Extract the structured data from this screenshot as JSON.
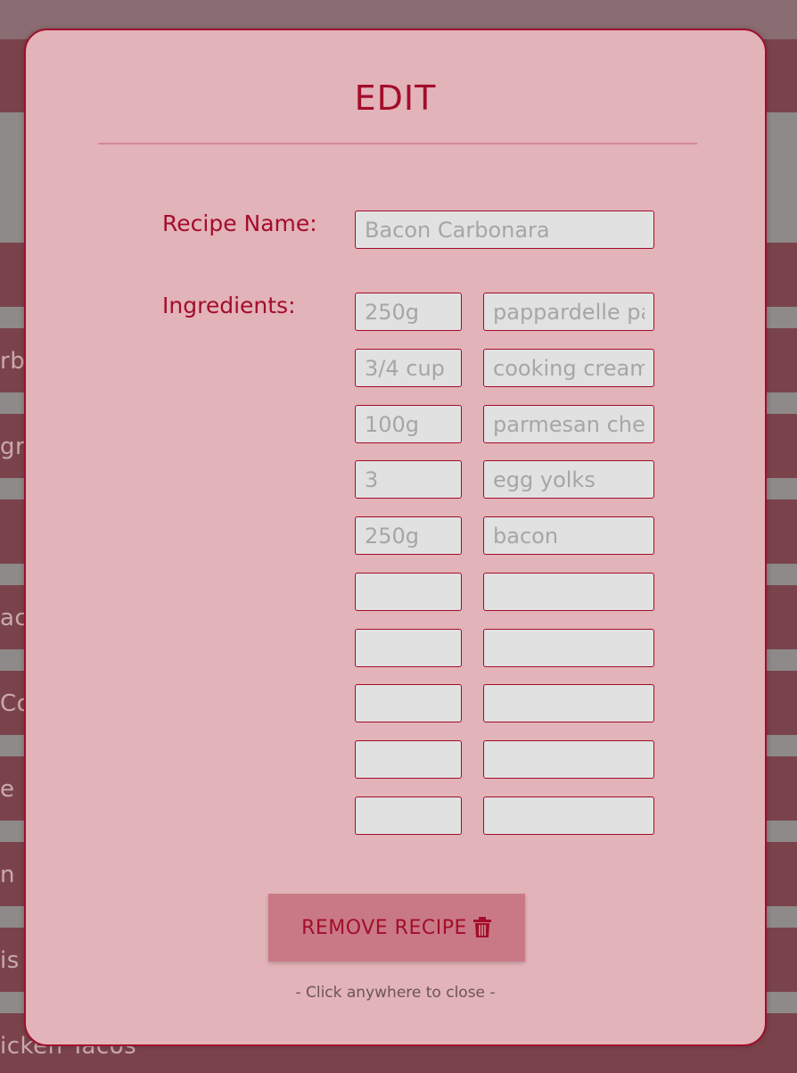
{
  "background": {
    "row_fragments": [
      "rb",
      "gr",
      "ac",
      "Co",
      "e S",
      "n R",
      "is",
      "icken Tacos"
    ]
  },
  "modal": {
    "title": "EDIT",
    "recipe_name_label": "Recipe Name:",
    "recipe_name_placeholder": "Bacon Carbonara",
    "ingredients_label": "Ingredients:",
    "ingredients": [
      {
        "qty": "250g",
        "item": "pappardelle pasta"
      },
      {
        "qty": "3/4 cup",
        "item": "cooking cream"
      },
      {
        "qty": "100g",
        "item": "parmesan cheese"
      },
      {
        "qty": "3",
        "item": "egg yolks"
      },
      {
        "qty": "250g",
        "item": "bacon"
      },
      {
        "qty": "",
        "item": ""
      },
      {
        "qty": "",
        "item": ""
      },
      {
        "qty": "",
        "item": ""
      },
      {
        "qty": "",
        "item": ""
      },
      {
        "qty": "",
        "item": ""
      }
    ],
    "remove_button_label": "REMOVE RECIPE",
    "close_hint": "- Click anywhere to close -"
  },
  "colors": {
    "accent": "#a30d2a",
    "modal_bg": "#e2b3b9",
    "button_bg": "#c97985",
    "input_bg": "#e1e1e1"
  },
  "icons": {
    "remove_button": "trash-icon"
  }
}
